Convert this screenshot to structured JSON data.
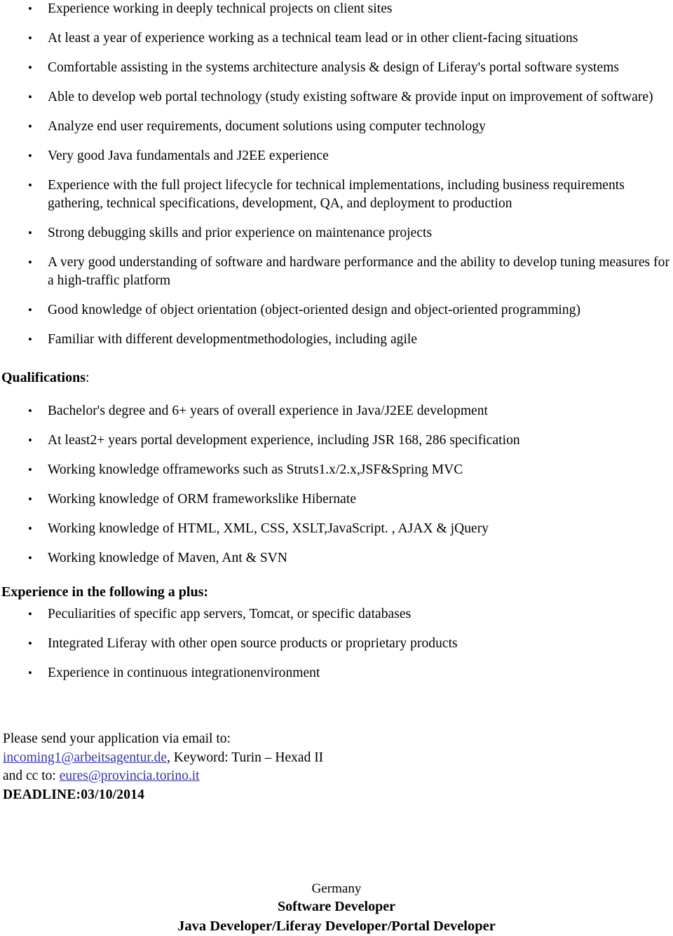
{
  "document": {
    "type": "job-posting-page",
    "responsibilities_bullets": [
      "Experience working in deeply technical projects on client sites",
      "At least a year of experience working as a technical team lead or in other client-facing situations",
      "Comfortable assisting in the systems architecture analysis & design of Liferay's portal software systems",
      "Able to develop web portal technology (study existing software & provide input on improvement of software)",
      "Analyze end user requirements, document solutions using computer technology",
      "Very good Java fundamentals and J2EE experience",
      "Experience with the full project lifecycle for technical implementations, including business requirements gathering, technical specifications, development, QA, and deployment to production",
      "Strong debugging skills and prior experience on maintenance projects",
      "A very good understanding of software and hardware performance and the ability to develop tuning measures for a high-traffic platform",
      "Good knowledge of object orientation (object-oriented design and object-oriented programming)",
      "Familiar with different developmentmethodologies, including agile"
    ],
    "qualifications_heading_bold": "Qualifications",
    "qualifications_heading_suffix": ":",
    "qualifications_bullets": [
      "Bachelor's degree and 6+ years of overall experience in Java/J2EE development",
      "At least2+ years portal development experience, including JSR 168, 286 specification",
      "Working knowledge offrameworks such as Struts1.x/2.x,JSF&Spring MVC",
      "Working knowledge of ORM frameworkslike Hibernate",
      "Working knowledge of HTML, XML, CSS, XSLT,JavaScript. , AJAX & jQuery",
      "Working knowledge of Maven, Ant & SVN"
    ],
    "plus_heading": "Experience in the following a plus:",
    "plus_bullets": [
      "Peculiarities of specific app servers, Tomcat, or specific databases",
      "Integrated Liferay with other open source products or proprietary products",
      "Experience in continuous integrationenvironment"
    ],
    "contact": {
      "intro": "Please send your application via email to:",
      "email_primary": "incoming1@arbeitsagentur.de",
      "keyword_text": ", Keyword: Turin  – Hexad II",
      "cc_prefix": "and cc to: ",
      "email_cc": "eures@provincia.torino.it",
      "deadline": "DEADLINE:03/10/2014",
      "link_color": "#3333AA"
    },
    "footer": {
      "country": "Germany",
      "role_title": "Software Developer",
      "role_subtitle": "Java Developer/Liferay Developer/Portal Developer"
    }
  }
}
